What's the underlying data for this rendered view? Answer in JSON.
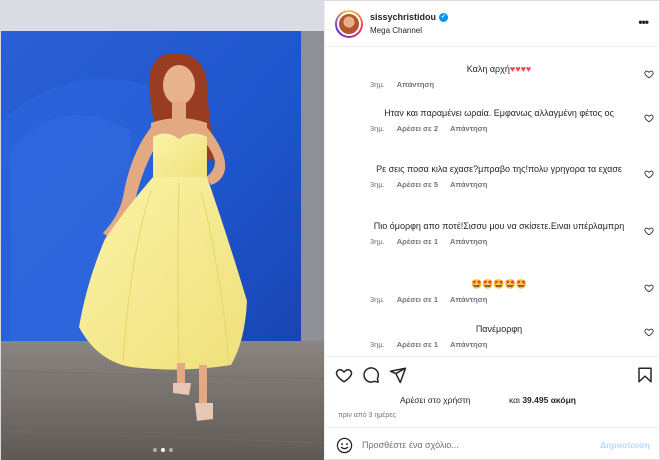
{
  "post": {
    "username": "sissychristidou",
    "subtitle": "Mega Channel",
    "more_label": "•••"
  },
  "comments": [
    {
      "text": "Καλη αρχή",
      "emoji": "♥♥♥♥",
      "time": "3ημ.",
      "likes": "",
      "reply": "Απάντηση"
    },
    {
      "text": "Ηταν και παραμένει ωραία. Εμφανως αλλαγμένη φέτος ος",
      "emoji": "",
      "time": "3ημ.",
      "likes": "Αρέσει σε 2",
      "reply": "Απάντηση"
    },
    {
      "text": "Ρε σεις ποσα κιλα εχασε?μπραβο της!πολυ γρηγορα τα εχασε",
      "emoji": "",
      "time": "3ημ.",
      "likes": "Αρέσει σε 5",
      "reply": "Απάντηση"
    },
    {
      "text": "Πιο όμορφη απο ποτέ!Σισσυ μου να σκίσετε.Ειναι υπέρλαμπρη",
      "emoji": "",
      "time": "3ημ.",
      "likes": "Αρέσει σε 1",
      "reply": "Απάντηση"
    },
    {
      "text": "",
      "emoji": "🤩🤩🤩🤩🤩",
      "time": "3ημ.",
      "likes": "Αρέσει σε 1",
      "reply": "Απάντηση"
    },
    {
      "text": "Πανέμορφη",
      "emoji": "",
      "time": "3ημ.",
      "likes": "Αρέσει σε 1",
      "reply": "Απάντηση"
    }
  ],
  "footer": {
    "likes_prefix": "Αρέσει στο χρήστη",
    "likes_and": "και",
    "likes_count": "39.495",
    "likes_suffix": "ακόμη",
    "time_ago": "πριν από 3 ημέρες",
    "comment_placeholder": "Προσθέστε ένα σχόλιο...",
    "post_label": "Δημοσίευση"
  },
  "colors": {
    "accent": "#0095f6",
    "heart": "#ed4956",
    "post_disabled": "#b3dbff"
  },
  "icons": [
    "verified-badge-icon",
    "more-icon",
    "heart-icon",
    "comment-icon",
    "share-icon",
    "bookmark-icon",
    "emoji-icon"
  ]
}
